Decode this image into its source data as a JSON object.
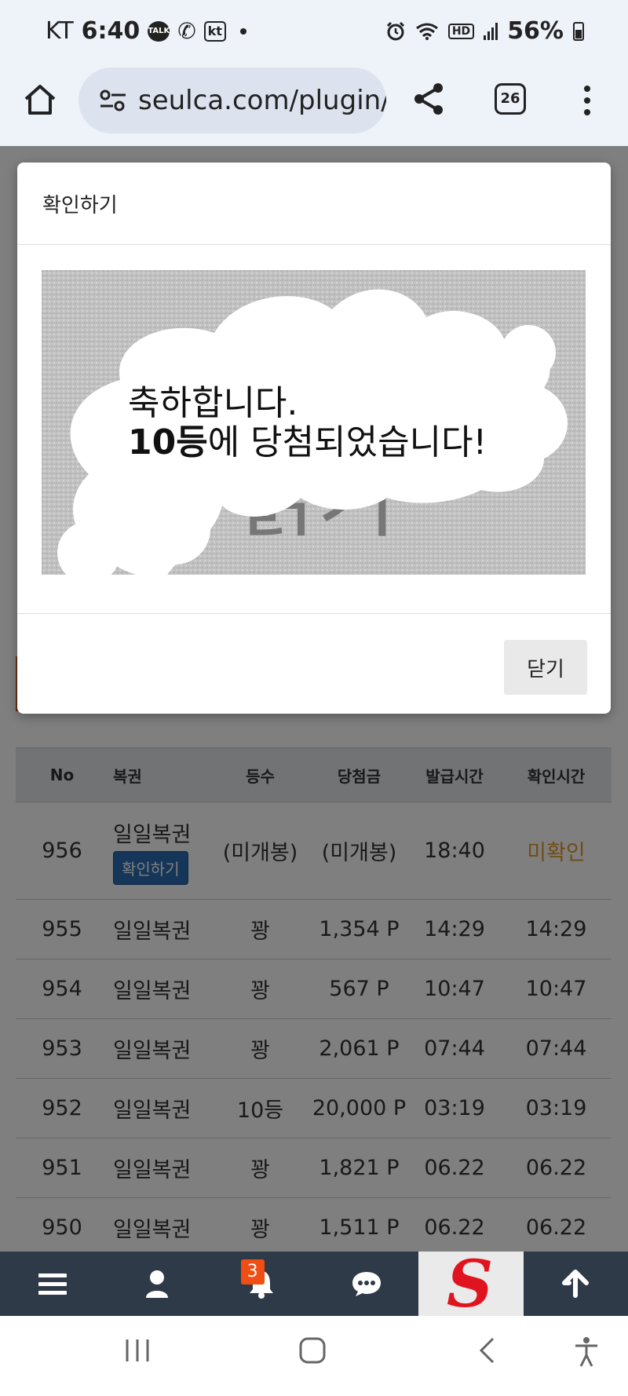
{
  "status_bar": {
    "carrier": "KT",
    "time": "6:40",
    "talk_icon_label": "TALK",
    "kt_icon_label": "kt",
    "hd_label": "HD",
    "battery": "56%"
  },
  "browser": {
    "url": "seulca.com/plugin/l",
    "tab_count": "26"
  },
  "modal": {
    "title": "확인하기",
    "card_line1": "축하합니다.",
    "card_line2_bold": "10등",
    "card_line2_rest": "에 당첨되었습니다!",
    "close_label": "닫기"
  },
  "table": {
    "headers": [
      "No",
      "복권",
      "등수",
      "당첨금",
      "발급시간",
      "확인시간"
    ],
    "rows": [
      {
        "no": "956",
        "name": "일일복권",
        "action": "확인하기",
        "rank": "(미개봉)",
        "prize": "(미개봉)",
        "issued": "18:40",
        "checked": "미확인"
      },
      {
        "no": "955",
        "name": "일일복권",
        "rank": "꽝",
        "prize": "1,354 P",
        "issued": "14:29",
        "checked": "14:29"
      },
      {
        "no": "954",
        "name": "일일복권",
        "rank": "꽝",
        "prize": "567 P",
        "issued": "10:47",
        "checked": "10:47"
      },
      {
        "no": "953",
        "name": "일일복권",
        "rank": "꽝",
        "prize": "2,061 P",
        "issued": "07:44",
        "checked": "07:44"
      },
      {
        "no": "952",
        "name": "일일복권",
        "rank": "10등",
        "prize": "20,000 P",
        "issued": "03:19",
        "checked": "03:19"
      },
      {
        "no": "951",
        "name": "일일복권",
        "rank": "꽝",
        "prize": "1,821 P",
        "issued": "06.22",
        "checked": "06.22"
      },
      {
        "no": "950",
        "name": "일일복권",
        "rank": "꽝",
        "prize": "1,511 P",
        "issued": "06.22",
        "checked": "06.22"
      }
    ]
  },
  "bottom_nav": {
    "notification_count": "3",
    "brand_letter": "S"
  },
  "colors": {
    "nav_bg": "#2f3a48",
    "badge": "#f04e12",
    "unchecked": "#e39a2a",
    "confirm_button": "#2b6cb0",
    "brand_red": "#e0141e"
  }
}
